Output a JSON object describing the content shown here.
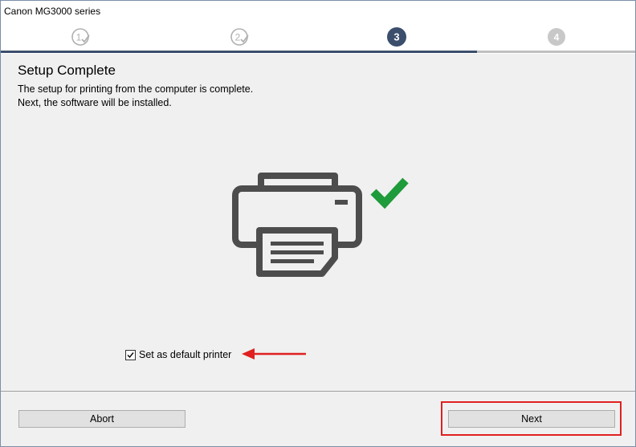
{
  "window": {
    "title": "Canon MG3000 series"
  },
  "steps": [
    {
      "label": "1",
      "state": "done"
    },
    {
      "label": "2",
      "state": "done"
    },
    {
      "label": "3",
      "state": "current"
    },
    {
      "label": "4",
      "state": "upcoming"
    }
  ],
  "main": {
    "heading": "Setup Complete",
    "description_line1": "The setup for printing from the computer is complete.",
    "description_line2": "Next, the software will be installed."
  },
  "illustration": {
    "printer_icon": "printer-icon",
    "check_icon": "checkmark-icon"
  },
  "default_printer": {
    "label": "Set as default printer",
    "checked": true
  },
  "footer": {
    "abort_label": "Abort",
    "next_label": "Next"
  },
  "colors": {
    "accent": "#3b4e6c",
    "check_green": "#1e9b3a",
    "annotation_red": "#e02020",
    "printer_gray": "#4d4d4d"
  }
}
